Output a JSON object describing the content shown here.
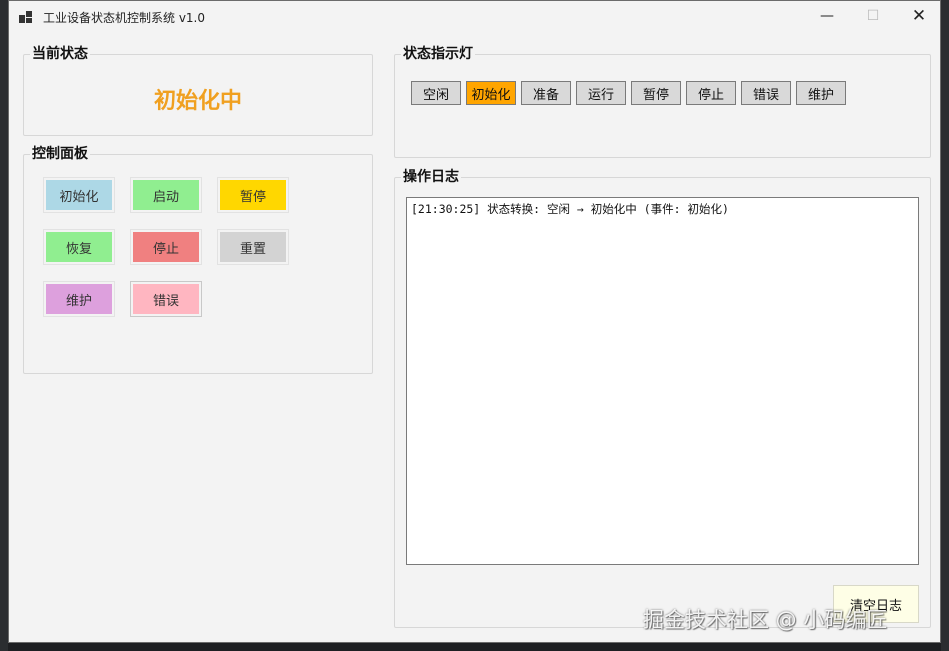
{
  "window": {
    "title": "工业设备状态机控制系统 v1.0",
    "minimize_glyph": "—",
    "maximize_glyph": "☐",
    "close_glyph": "✕"
  },
  "current_state": {
    "group_title": "当前状态",
    "value": "初始化中",
    "color": "#f0a020"
  },
  "control_panel": {
    "group_title": "控制面板",
    "buttons": [
      {
        "label": "初始化",
        "color": "#add8e6"
      },
      {
        "label": "启动",
        "color": "#90ee90"
      },
      {
        "label": "暂停",
        "color": "#ffd700"
      },
      {
        "label": "恢复",
        "color": "#90ee90"
      },
      {
        "label": "停止",
        "color": "#f08080"
      },
      {
        "label": "重置",
        "color": "#d3d3d3"
      },
      {
        "label": "维护",
        "color": "#dda0dd"
      },
      {
        "label": "错误",
        "color": "#ffb6c1"
      }
    ]
  },
  "status_lights": {
    "group_title": "状态指示灯",
    "active_index": 1,
    "active_color": "#ffa500",
    "items": [
      {
        "label": "空闲"
      },
      {
        "label": "初始化"
      },
      {
        "label": "准备"
      },
      {
        "label": "运行"
      },
      {
        "label": "暂停"
      },
      {
        "label": "停止"
      },
      {
        "label": "错误"
      },
      {
        "label": "维护"
      }
    ]
  },
  "log": {
    "group_title": "操作日志",
    "entries": [
      "[21:30:25] 状态转换: 空闲 → 初始化中 (事件: 初始化)"
    ],
    "clear_label": "清空日志"
  },
  "watermark": "掘金技术社区 @ 小码编匠"
}
